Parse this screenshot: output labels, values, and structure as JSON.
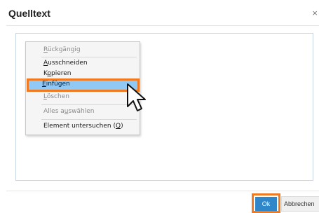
{
  "dialog": {
    "title": "Quelltext",
    "close_glyph": "×"
  },
  "context_menu": {
    "items": [
      {
        "pre": "",
        "key": "R",
        "post": "ückgängig",
        "enabled": false
      },
      {
        "pre": "",
        "key": "A",
        "post": "usschneiden",
        "enabled": true
      },
      {
        "pre": "K",
        "key": "o",
        "post": "pieren",
        "enabled": true
      },
      {
        "pre": "",
        "key": "E",
        "post": "infügen",
        "enabled": true,
        "highlighted": true
      },
      {
        "pre": "",
        "key": "L",
        "post": "öschen",
        "enabled": false
      },
      {
        "pre": "Alles a",
        "key": "u",
        "post": "swählen",
        "enabled": false
      },
      {
        "pre": "Element untersuchen (",
        "key": "Q",
        "post": ")",
        "enabled": true
      }
    ]
  },
  "footer": {
    "ok_label": "Ok",
    "cancel_label": "Abbrechen"
  },
  "colors": {
    "ok_button": "#2f87c9",
    "highlight_border": "#f07a22",
    "selected_item": "#90c8f6"
  },
  "icons": {
    "cursor": "arrow-pointer-icon",
    "close": "close-icon"
  }
}
